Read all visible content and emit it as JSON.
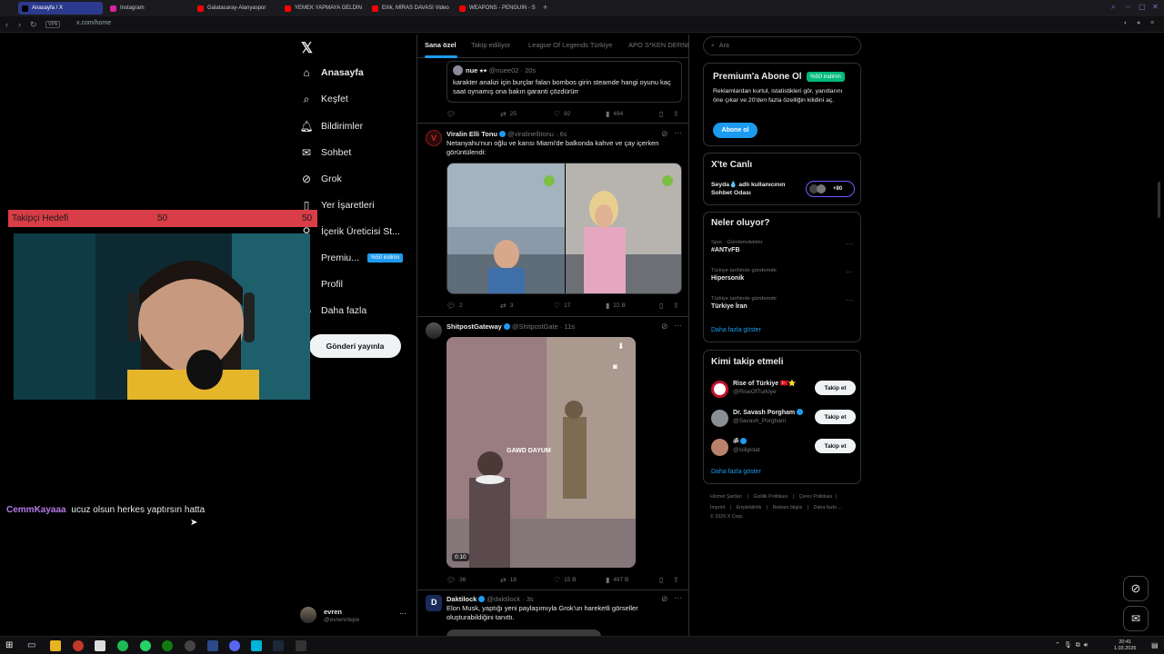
{
  "browser": {
    "tabs": [
      {
        "label": "Anasayfa / X",
        "active": true
      },
      {
        "label": "Instagram"
      },
      {
        "label": "Galatasaray-Alanyaspor"
      },
      {
        "label": "YEMEK YAPMAYA GELDİN"
      },
      {
        "label": "Erlik, MİRAS DAVASI Video"
      },
      {
        "label": "WEAPONS - PENGUIN - S"
      }
    ],
    "vpn_label": "VPN",
    "url": "x.com/home"
  },
  "nav": {
    "items": [
      {
        "label": "Anasayfa",
        "icon": "home-icon"
      },
      {
        "label": "Keşfet",
        "icon": "search-icon"
      },
      {
        "label": "Bildirimler",
        "icon": "bell-icon"
      },
      {
        "label": "Sohbet",
        "icon": "mail-icon"
      },
      {
        "label": "Grok",
        "icon": "grok-icon"
      },
      {
        "label": "Yer İşaretleri",
        "icon": "bookmark-icon"
      },
      {
        "label": "İçerik Üreticisi St...",
        "icon": "creator-studio-icon"
      },
      {
        "label": "Premiu...",
        "icon": "x-premium-icon"
      },
      {
        "label": "Profil",
        "icon": "profile-icon"
      },
      {
        "label": "Daha fazla",
        "icon": "more-circle-icon"
      }
    ],
    "premium_badge": "%50 indirim",
    "post_button": "Gönderi yayınla",
    "account": {
      "name": "evren",
      "handle": "@evrenntepe"
    }
  },
  "overlay": {
    "goal_label": "Takipçi Hedefi",
    "goal_current": "50",
    "goal_target": "50",
    "chat_user": "CemmKayaaa",
    "chat_message": "ucuz olsun herkes yaptırsın hatta"
  },
  "feed": {
    "tabs": [
      "Sana özel",
      "Takip ediliyor",
      "League Of Legends Türkiye",
      "APO S*KEN DERNE"
    ],
    "posts": [
      {
        "quote_name": "nue ⭑⭒",
        "quote_handle": "@nuee02 · 20s",
        "quote_text": "karakter analizi için burçlar falan bombos girin steamde hangi oyunu kaç saat oynamış ona bakın garanti çözdürürr",
        "replies": "",
        "reposts": "25",
        "likes": "92",
        "views": "494"
      },
      {
        "name": "Viralin Elli Tonu",
        "handle": "@viralinellitonu · 6s",
        "text": "Netanyahu'nun oğlu ve karısı Miami'de balkonda kahve ve çay içerken görüntülendi:",
        "replies": "2",
        "reposts": "3",
        "likes": "17",
        "views": "22 B"
      },
      {
        "name": "ShitpostGateway",
        "handle": "@ShitpostGate · 11s",
        "media_caption": "GAWD DAYUM",
        "video_time": "0:10",
        "replies": "36",
        "reposts": "18",
        "likes": "15 B",
        "views": "497 B"
      },
      {
        "name": "Daktilock",
        "handle": "@daktilock · 3s",
        "text": "Elon Musk, yaptığı yeni paylaşımıyla Grok'un hareketli görseller oluşturabildiğini tanıttı."
      }
    ]
  },
  "right": {
    "search_placeholder": "Ara",
    "premium": {
      "title": "Premium'a Abone Ol",
      "badge": "%50 indirim",
      "desc": "Reklamlardan kurtul, istatistikleri gör, yanıtlarını öne çıkar ve 20'den fazla özelliğin kilidini aç.",
      "button": "Abone ol"
    },
    "live": {
      "title": "X'te Canlı",
      "text_bold": "Seyda💧",
      "text_rest": " adlı kullanıcının Sohbet Odası",
      "count": "+80"
    },
    "trends": {
      "title": "Neler oluyor?",
      "items": [
        {
          "meta": "Spor · Gündemdekiler",
          "name": "#ANTvFB"
        },
        {
          "meta": "Türkiye tarihinde gündemde",
          "name": "Hipersonik"
        },
        {
          "meta": "Türkiye tarihinde gündemde",
          "name": "Türkiye İran"
        }
      ],
      "more": "Daha fazla göster"
    },
    "who": {
      "title": "Kimi takip etmeli",
      "items": [
        {
          "name": "Rise of Türkiye 🇹🇷⭐",
          "handle": "@RiseOfTurkiye"
        },
        {
          "name": "Dr. Savash Porgham",
          "handle": "@Savash_Porgham"
        },
        {
          "name": "ॐ",
          "handle": "@isilipolat"
        }
      ],
      "button": "Takip et",
      "more": "Daha fazla göster"
    },
    "footer": {
      "links1": [
        "Hizmet Şartları",
        "Gizlilik Politikası",
        "Çerez Politikası"
      ],
      "links2": [
        "İmprint",
        "Erişilebilirlik",
        "Reklam bilgisi",
        "Daha fazla ..."
      ],
      "copyright": "© 2026 X Corp."
    }
  },
  "taskbar": {
    "time": "20:41",
    "date": "1.03.2026"
  }
}
